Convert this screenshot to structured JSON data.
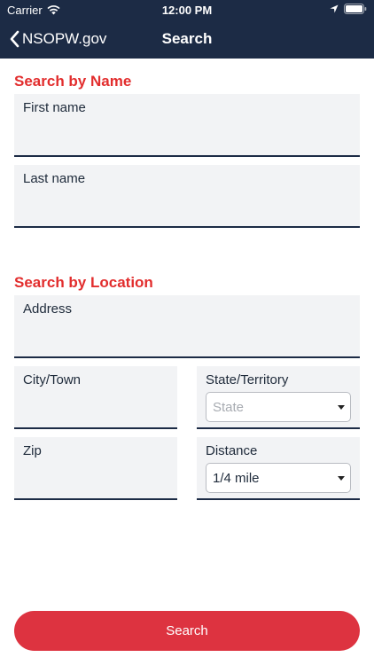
{
  "status_bar": {
    "carrier": "Carrier",
    "time": "12:00 PM"
  },
  "nav": {
    "back_label": "NSOPW.gov",
    "title": "Search"
  },
  "name_section": {
    "title": "Search by Name",
    "first_name_label": "First name",
    "first_name_value": "",
    "last_name_label": "Last name",
    "last_name_value": ""
  },
  "location_section": {
    "title": "Search by Location",
    "address_label": "Address",
    "address_value": "",
    "city_label": "City/Town",
    "city_value": "",
    "state_label": "State/Territory",
    "state_placeholder": "State",
    "zip_label": "Zip",
    "zip_value": "",
    "distance_label": "Distance",
    "distance_value": "1/4 mile"
  },
  "search_button_label": "Search",
  "colors": {
    "nav_bg": "#1c2b45",
    "accent_red": "#e22d2d",
    "button_red": "#dd3340",
    "field_bg": "#f2f3f5"
  }
}
